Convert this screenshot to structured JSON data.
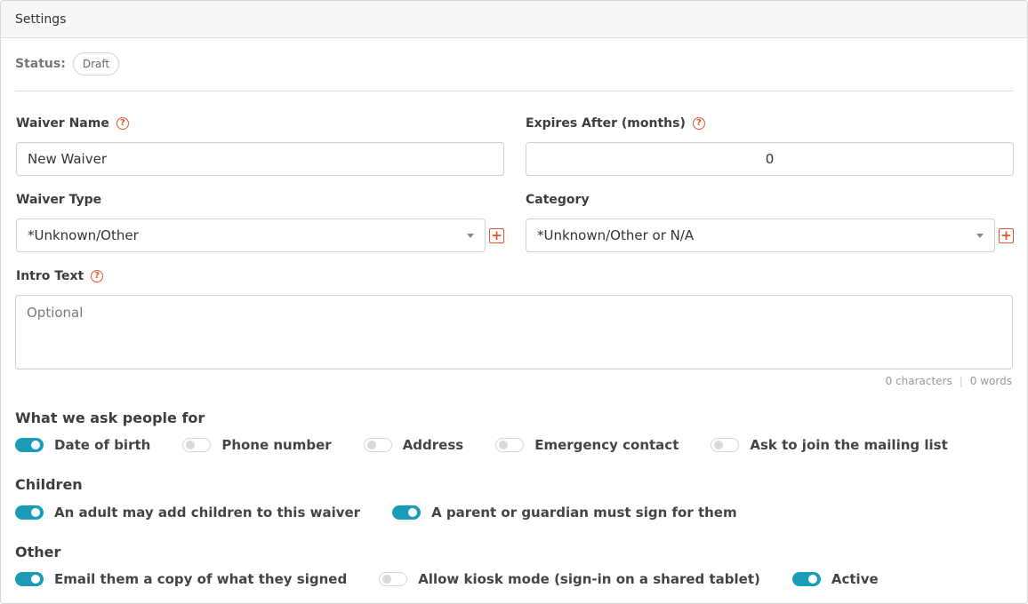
{
  "header": {
    "title": "Settings"
  },
  "status": {
    "label": "Status:",
    "value": "Draft"
  },
  "form": {
    "waiver_name": {
      "label": "Waiver Name",
      "value": "New Waiver"
    },
    "expires_after": {
      "label": "Expires After (months)",
      "value": "0"
    },
    "waiver_type": {
      "label": "Waiver Type",
      "value": "*Unknown/Other"
    },
    "category": {
      "label": "Category",
      "value": "*Unknown/Other or N/A"
    },
    "intro_text": {
      "label": "Intro Text",
      "placeholder": "Optional",
      "chars": "0 characters",
      "sep": "|",
      "words": "0 words"
    }
  },
  "ask": {
    "title": "What we ask people for",
    "items": [
      {
        "label": "Date of birth",
        "on": true
      },
      {
        "label": "Phone number",
        "on": false
      },
      {
        "label": "Address",
        "on": false
      },
      {
        "label": "Emergency contact",
        "on": false
      },
      {
        "label": "Ask to join the mailing list",
        "on": false
      }
    ]
  },
  "children": {
    "title": "Children",
    "items": [
      {
        "label": "An adult may add children to this waiver",
        "on": true
      },
      {
        "label": "A parent or guardian must sign for them",
        "on": true
      }
    ]
  },
  "other": {
    "title": "Other",
    "items": [
      {
        "label": "Email them a copy of what they signed",
        "on": true
      },
      {
        "label": "Allow kiosk mode (sign-in on a shared tablet)",
        "on": false
      },
      {
        "label": "Active",
        "on": true
      }
    ]
  },
  "icons": {
    "help": "question-circle-icon",
    "add": "plus-square-icon",
    "caret": "caret-down-icon"
  },
  "colors": {
    "accent": "#1a9cb8",
    "help": "#e0562a"
  }
}
